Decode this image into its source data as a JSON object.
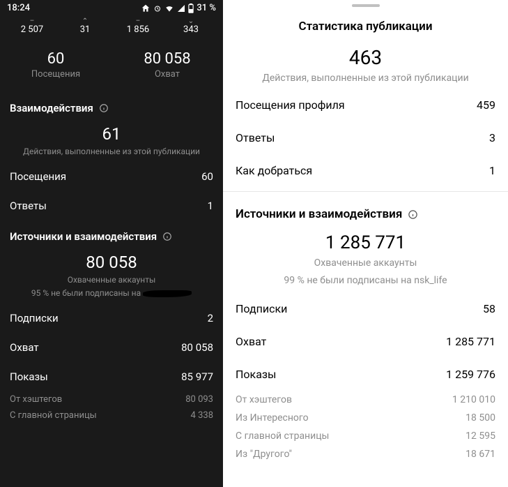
{
  "left": {
    "status": {
      "time": "18:24",
      "battery": "31 %"
    },
    "miniStats": [
      "2 507",
      "31",
      "1 856",
      "343"
    ],
    "pair": {
      "visits": {
        "value": "60",
        "label": "Посещения"
      },
      "reach": {
        "value": "80 058",
        "label": "Охват"
      }
    },
    "interactions": {
      "header": "Взаимодействия",
      "bigNumber": "61",
      "subtitle": "Действия, выполненные из этой публикации",
      "rows": [
        {
          "k": "Посещения",
          "v": "60"
        },
        {
          "k": "Ответы",
          "v": "1"
        }
      ]
    },
    "sources": {
      "header": "Источники и взаимодействия",
      "bigNumber": "80 058",
      "subtitle1": "Охваченные аккаунты",
      "subtitle2": "95 % не были подписаны на",
      "rows": [
        {
          "k": "Подписки",
          "v": "2"
        },
        {
          "k": "Охват",
          "v": "80 058"
        },
        {
          "k": "Показы",
          "v": "85 977"
        }
      ],
      "subrows": [
        {
          "k": "От хэштегов",
          "v": "80 093"
        },
        {
          "k": "С главной страницы",
          "v": "4 338"
        }
      ]
    }
  },
  "right": {
    "title": "Статистика публикации",
    "top": {
      "bigNumber": "463",
      "subtitle": "Действия, выполненные из этой публикации",
      "rows": [
        {
          "k": "Посещения профиля",
          "v": "459"
        },
        {
          "k": "Ответы",
          "v": "3"
        },
        {
          "k": "Как добраться",
          "v": "1"
        }
      ]
    },
    "sources": {
      "header": "Источники и взаимодействия",
      "bigNumber": "1 285 771",
      "subtitle1": "Охваченные аккаунты",
      "subtitle2": "99 % не были подписаны на nsk_life",
      "rows": [
        {
          "k": "Подписки",
          "v": "58"
        },
        {
          "k": "Охват",
          "v": "1 285 771"
        },
        {
          "k": "Показы",
          "v": "1 259 776"
        }
      ],
      "subrows": [
        {
          "k": "От хэштегов",
          "v": "1 210 010"
        },
        {
          "k": "Из Интересного",
          "v": "18 500"
        },
        {
          "k": "С главной страницы",
          "v": "12 595"
        },
        {
          "k": "Из \"Другого\"",
          "v": "18 671"
        }
      ]
    }
  }
}
